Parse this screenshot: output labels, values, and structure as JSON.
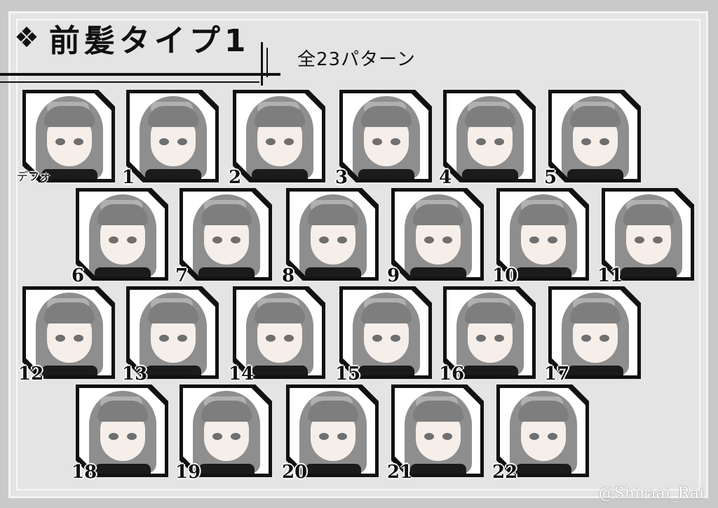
{
  "title": {
    "icon": "diamond-icon",
    "text": "前髪タイプ1",
    "subtitle": "全23パターン"
  },
  "cards": [
    {
      "label": "デフォ"
    },
    {
      "label": "1"
    },
    {
      "label": "2"
    },
    {
      "label": "3"
    },
    {
      "label": "4"
    },
    {
      "label": "5"
    },
    {
      "label": "6"
    },
    {
      "label": "7"
    },
    {
      "label": "8"
    },
    {
      "label": "9"
    },
    {
      "label": "10"
    },
    {
      "label": "11"
    },
    {
      "label": "12"
    },
    {
      "label": "13"
    },
    {
      "label": "14"
    },
    {
      "label": "15"
    },
    {
      "label": "16"
    },
    {
      "label": "17"
    },
    {
      "label": "18"
    },
    {
      "label": "19"
    },
    {
      "label": "20"
    },
    {
      "label": "21"
    },
    {
      "label": "22"
    }
  ],
  "credit": "@Shiraai_Rai"
}
